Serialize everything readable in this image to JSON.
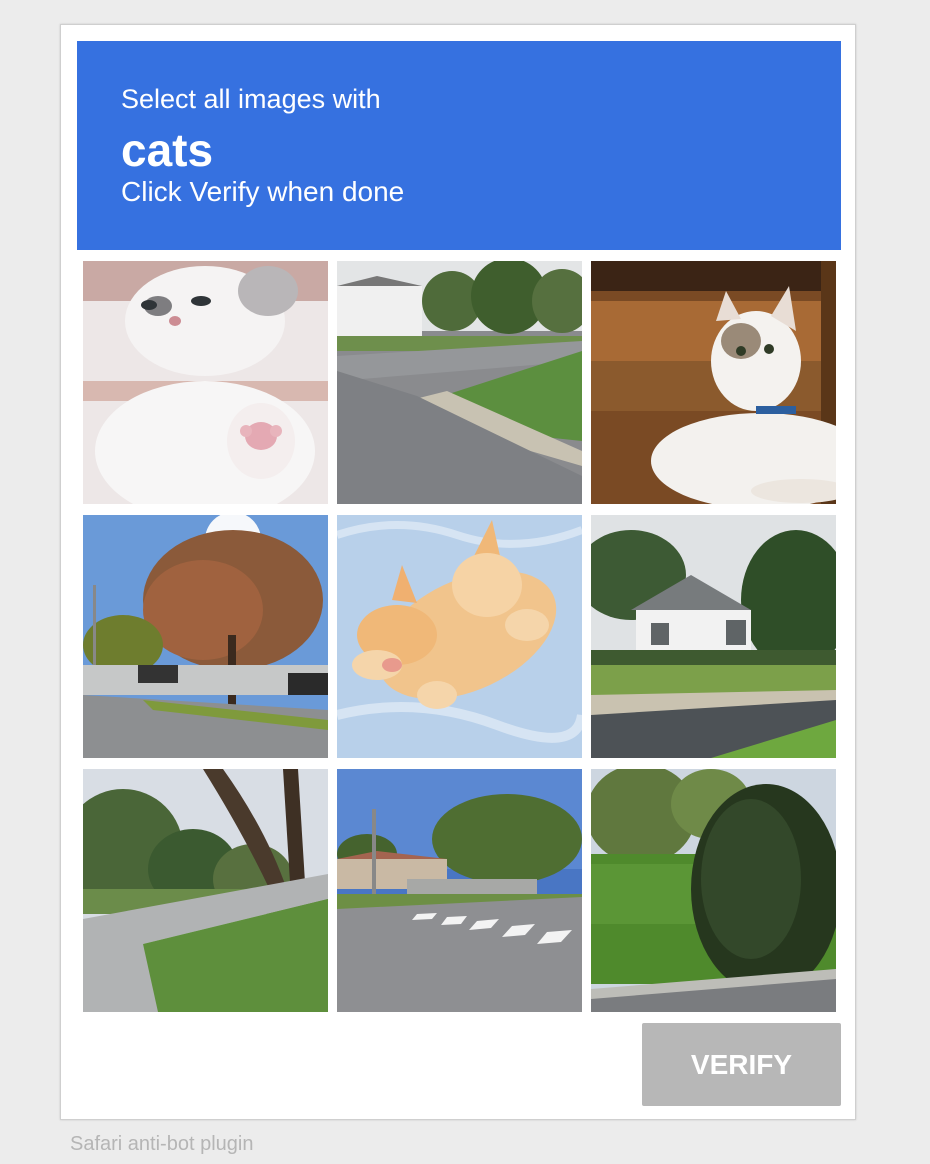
{
  "prompt": {
    "line1": "Select all images with",
    "target": "cats",
    "line3": "Click Verify when done"
  },
  "tiles": [
    {
      "label": "kitten-white-gray-paw"
    },
    {
      "label": "suburban-street-corner"
    },
    {
      "label": "white-cat-lying"
    },
    {
      "label": "autumn-tree-parking-lot"
    },
    {
      "label": "orange-kitten-sleeping-blue-blanket"
    },
    {
      "label": "white-house-driveway"
    },
    {
      "label": "bike-path-tree-trunk"
    },
    {
      "label": "street-crosswalk"
    },
    {
      "label": "large-bush-lawn"
    }
  ],
  "verify_label": "VERIFY",
  "footer": "Safari anti-bot plugin",
  "colors": {
    "header_bg": "#3671e0",
    "verify_bg": "#b7b7b7",
    "page_bg": "#ececec"
  }
}
